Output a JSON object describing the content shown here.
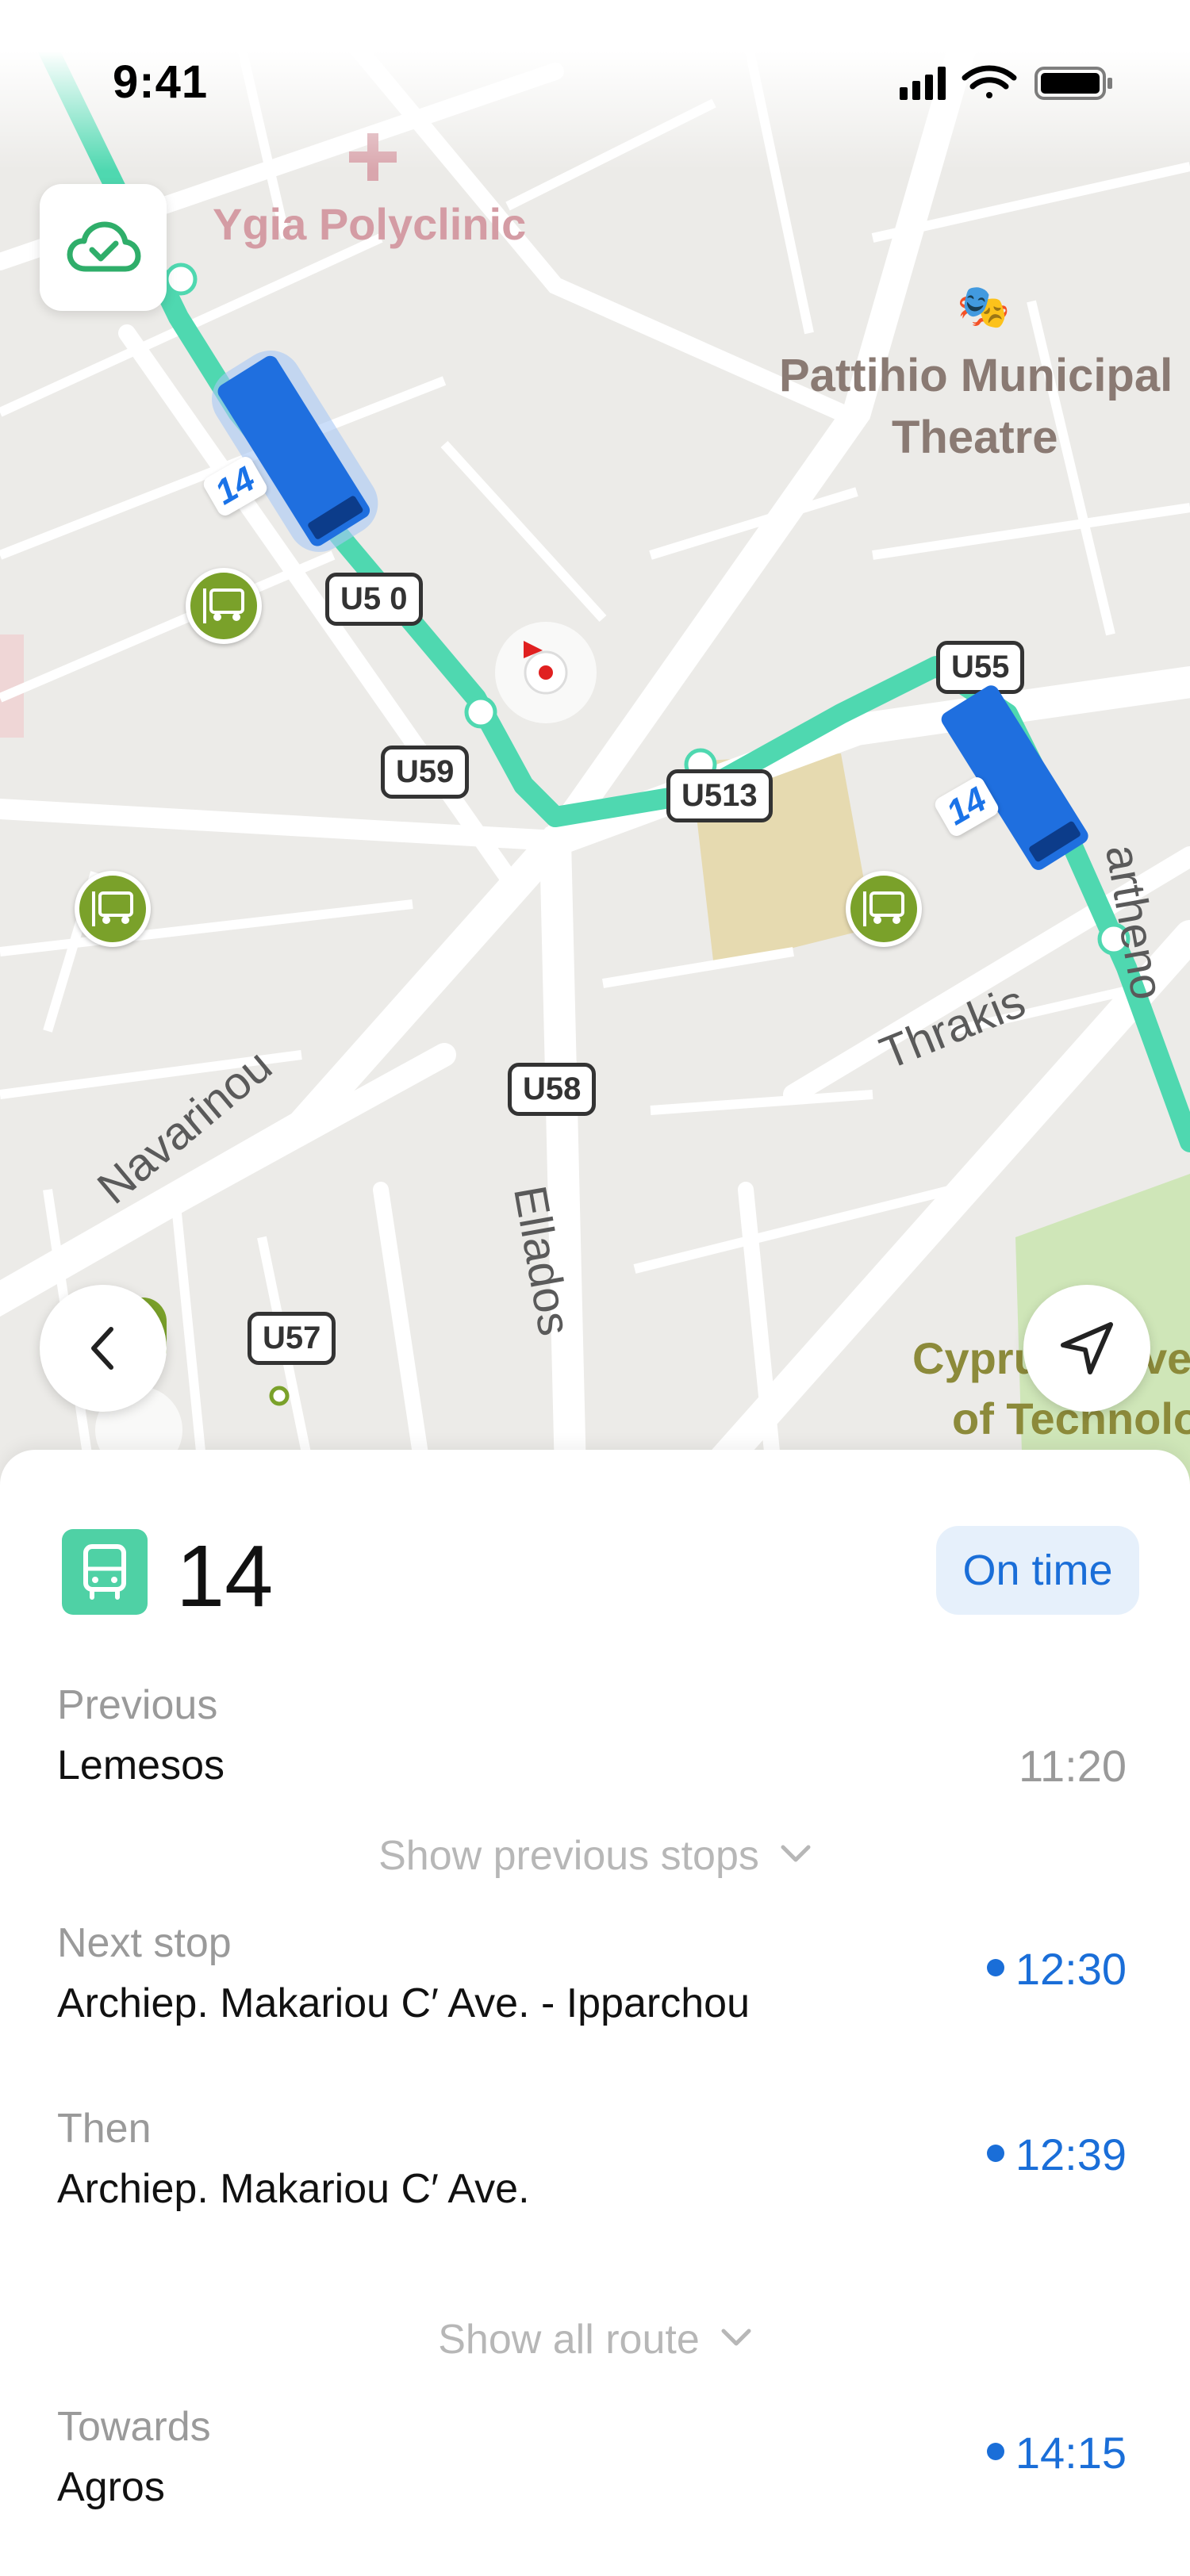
{
  "status_bar": {
    "time": "9:41"
  },
  "map": {
    "places": {
      "polyclinic": "Ygia Polyclinic",
      "theatre_line1": "Pattihio Municipal",
      "theatre_line2": "Theatre",
      "university_line1": "Cypru",
      "university_line1b": "ve",
      "university_line2": "of Tecnnolo"
    },
    "streets": {
      "navarinou": "Navarinou",
      "ellados": "Ellados",
      "thrakis": "Thrakis",
      "partheno": "artheno"
    },
    "shields": [
      "U5 0",
      "U59",
      "U513",
      "U55",
      "U58",
      "U57"
    ],
    "bus_tags": [
      "14",
      "14"
    ],
    "colors": {
      "route": "#4fd8b0",
      "bus": "#1f6fdf",
      "stop": "#7aa12a"
    }
  },
  "sheet": {
    "route_number": "14",
    "status": "On time",
    "previous": {
      "caption": "Previous",
      "name": "Lemesos",
      "time": "11:20"
    },
    "show_previous": "Show previous stops",
    "next": {
      "caption": "Next stop",
      "name": "Archiep. Makariou C′ Ave. - Ipparchou",
      "time": "12:30"
    },
    "then": {
      "caption": "Then",
      "name": "Archiep. Makariou C′ Ave.",
      "time": "12:39"
    },
    "show_all": "Show all route",
    "towards": {
      "caption": "Towards",
      "name": "Agros",
      "time": "14:15"
    }
  }
}
